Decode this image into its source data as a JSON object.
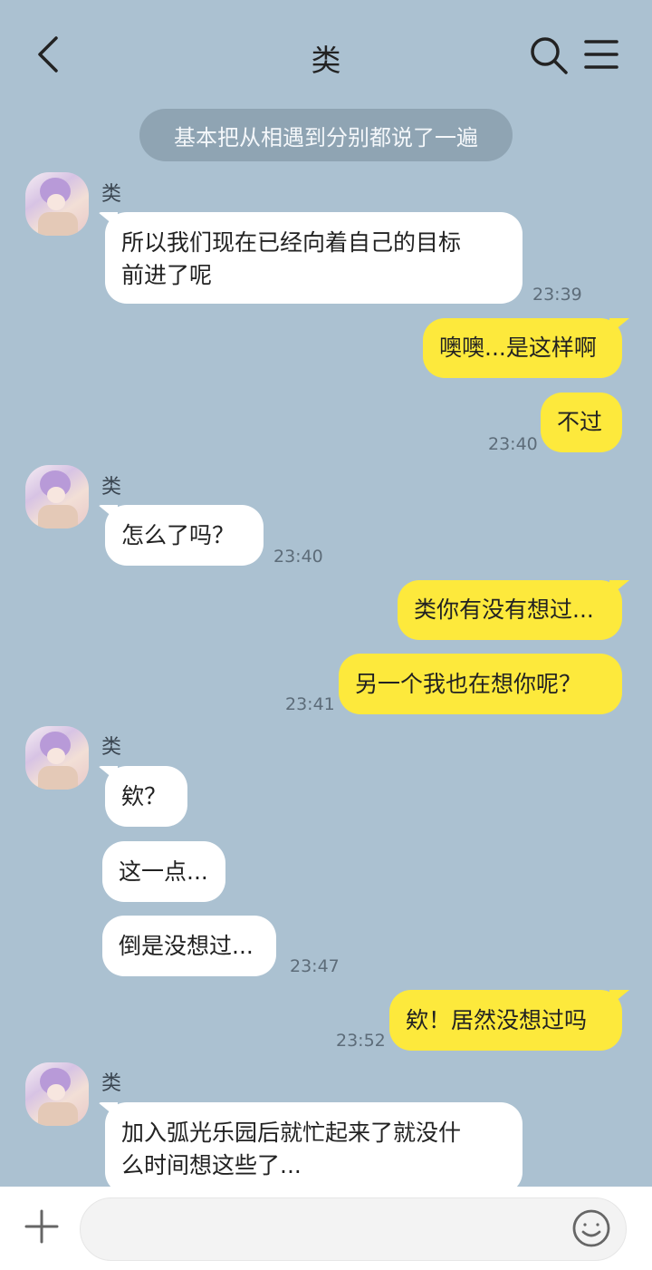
{
  "header": {
    "title": "类",
    "back_icon": "chevron-left-icon",
    "search_icon": "search-icon",
    "menu_icon": "hamburger-menu-icon"
  },
  "notice": "基本把从相遇到分别都说了一遍",
  "messages": [
    {
      "sender": "类",
      "text": "所以我们现在已经向着自己的目标\n前进了呢",
      "time": "23:39"
    },
    {
      "text": "噢噢...是这样啊"
    },
    {
      "text": "不过",
      "time": "23:40"
    },
    {
      "sender": "类",
      "text": "怎么了吗？",
      "time": "23:40"
    },
    {
      "text": "类你有没有想过..."
    },
    {
      "text": "另一个我也在想你呢？",
      "time": "23:41"
    },
    {
      "sender": "类",
      "text": "欸？"
    },
    {
      "text": "这一点..."
    },
    {
      "text": "倒是没想过...",
      "time": "23:47"
    },
    {
      "text": "欸！居然没想过吗",
      "time": "23:52"
    },
    {
      "sender": "类",
      "text": "加入弧光乐园后就忙起来了就没什\n么时间想这些了..."
    }
  ],
  "input_bar": {
    "plus_icon": "plus-icon",
    "emoji_icon": "smiley-icon",
    "value": "",
    "placeholder": ""
  },
  "colors": {
    "background": "#abc1d1",
    "outgoing_bubble": "#fde93c",
    "incoming_bubble": "#ffffff",
    "notice_pill": "#8fa4b3"
  }
}
